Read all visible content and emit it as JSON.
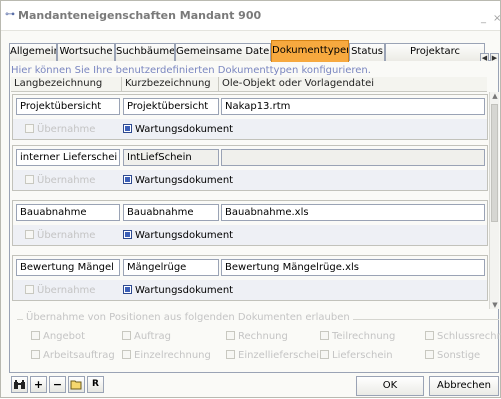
{
  "window": {
    "title": "Mandanteneigenschaften Mandant 900",
    "minimize": "_",
    "close": "×"
  },
  "tabs": [
    {
      "label": "Allgemein"
    },
    {
      "label": "Wortsuche"
    },
    {
      "label": "Suchbäume"
    },
    {
      "label": "Gemeinsame Daten"
    },
    {
      "label": "Dokumenttypen",
      "active": true
    },
    {
      "label": "Status"
    },
    {
      "label": "Projektarc"
    }
  ],
  "hint": "Hier können Sie Ihre benutzerdefinierten Dokumenttypen konfigurieren.",
  "columns": {
    "long": "Langbezeichnung",
    "short": "Kurzbezeichnung",
    "ole": "Ole-Objekt oder Vorlagendatei"
  },
  "rows": [
    {
      "long": "Projektübersicht",
      "short": "Projektübersicht",
      "ole": "Nakap13.rtm",
      "uebernahme": "Übernahme",
      "wartung": "Wartungsdokument"
    },
    {
      "long": "interner Lieferschei",
      "short": "IntLiefSchein",
      "ole": "",
      "uebernahme": "Übernahme",
      "wartung": "Wartungsdokument"
    },
    {
      "long": "Bauabnahme",
      "short": "Bauabnahme",
      "ole": "Bauabnahme.xls",
      "uebernahme": "Übernahme",
      "wartung": "Wartungsdokument"
    },
    {
      "long": "Bewertung Mängel",
      "short": "Mängelrüge",
      "ole": "Bewertung Mängelrüge.xls",
      "uebernahme": "Übernahme",
      "wartung": "Wartungsdokument"
    }
  ],
  "fieldset": {
    "legend": "Übernahme von Positionen aus folgenden Dokumenten erlauben",
    "items": [
      "Angebot",
      "Auftrag",
      "Rechnung",
      "Teilrechnung",
      "Schlussrechnung",
      "Arbeitsauftrag",
      "Einzelrechnung",
      "Einzellieferschein",
      "Lieferschein",
      "Sonstige"
    ]
  },
  "buttons": {
    "ok": "OK",
    "cancel": "Abbrechen"
  },
  "toolbar": {
    "search": "🔍",
    "add": "+",
    "remove": "−",
    "open": "📂",
    "props": "R"
  },
  "colors": {
    "active_tab": "#f7a93f",
    "checked": "#3b5fb8"
  }
}
